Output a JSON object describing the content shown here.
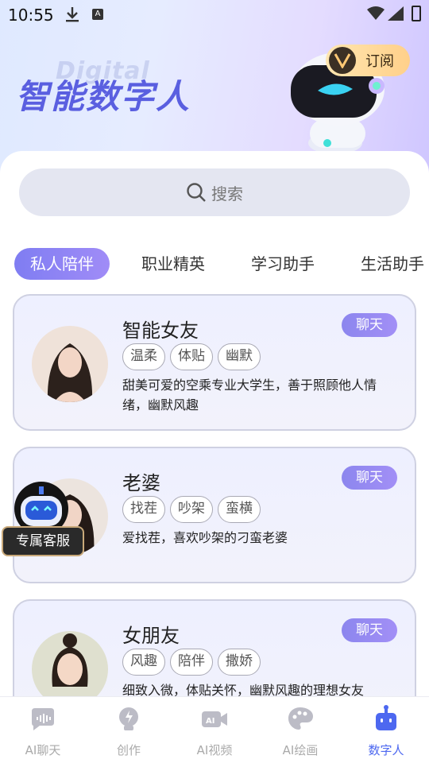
{
  "status_bar": {
    "time": "10:55",
    "notif_letter": "A"
  },
  "header": {
    "title": "智能数字人",
    "ghost_text": "Digital",
    "subscribe_label": "订阅"
  },
  "search": {
    "placeholder": "搜索"
  },
  "tabs": [
    {
      "label": "私人陪伴",
      "active": true
    },
    {
      "label": "职业精英",
      "active": false
    },
    {
      "label": "学习助手",
      "active": false
    },
    {
      "label": "生活助手",
      "active": false
    }
  ],
  "cards": [
    {
      "name": "智能女友",
      "chat_label": "聊天",
      "tags": [
        "温柔",
        "体贴",
        "幽默"
      ],
      "desc": "甜美可爱的空乘专业大学生，善于照顾他人情绪，幽默风趣"
    },
    {
      "name": "老婆",
      "chat_label": "聊天",
      "tags": [
        "找茬",
        "吵架",
        "蛮横"
      ],
      "desc": "爱找茬，喜欢吵架的刁蛮老婆"
    },
    {
      "name": "女朋友",
      "chat_label": "聊天",
      "tags": [
        "风趣",
        "陪伴",
        "撒娇"
      ],
      "desc": "细致入微，体贴关怀，幽默风趣的理想女友"
    }
  ],
  "service": {
    "label": "专属客服"
  },
  "nav": [
    {
      "label": "AI聊天",
      "icon": "chat-bubble-icon",
      "active": false
    },
    {
      "label": "创作",
      "icon": "lightbulb-icon",
      "active": false
    },
    {
      "label": "AI视频",
      "icon": "video-camera-icon",
      "active": false
    },
    {
      "label": "AI绘画",
      "icon": "palette-icon",
      "active": false
    },
    {
      "label": "数字人",
      "icon": "robot-icon",
      "active": true
    }
  ],
  "colors": {
    "accent": "#8c86ee",
    "nav_active": "#4d68f0",
    "title": "#5a5fe0"
  }
}
